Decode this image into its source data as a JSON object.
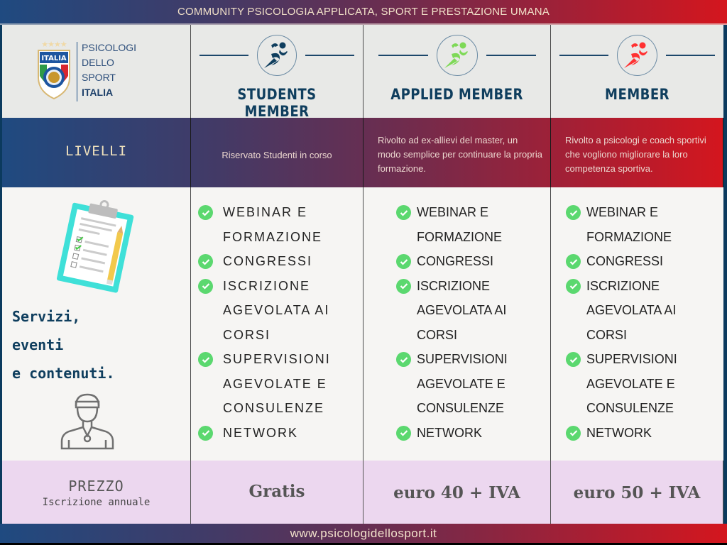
{
  "header": {
    "title": "COMMUNITY PSICOLOGIA APPLICATA, SPORT E PRESTAZIONE UMANA"
  },
  "logo": {
    "crest_label": "ITALIA",
    "stars": "★★★★",
    "lines": [
      "PSICOLOGI",
      "DELLO",
      "SPORT",
      "ITALIA"
    ]
  },
  "colors": {
    "navy": "#0f3e5e",
    "check_green": "#5bd86f",
    "runner_students": "#0f3e5e",
    "runner_applied": "#7ed957",
    "runner_member": "#ff3131",
    "price_row_bg": "#ecd7ef"
  },
  "plans": [
    {
      "title": "STUDENTS MEMBER",
      "icon": "runner-icon",
      "description": "Riservato Studenti in corso",
      "price": "Gratis",
      "features": [
        "WEBINAR E FORMAZIONE",
        "CONGRESSI",
        "ISCRIZIONE AGEVOLATA AI CORSI",
        "SUPERVISIONI AGEVOLATE E CONSULENZE",
        "NETWORK"
      ]
    },
    {
      "title": "APPLIED MEMBER",
      "icon": "runner-icon",
      "description": "Rivolto ad ex-allievi del master, un modo semplice per continuare la propria formazione.",
      "price": "euro 40 + IVA",
      "features": [
        "WEBINAR E FORMAZIONE",
        "CONGRESSI",
        "ISCRIZIONE AGEVOLATA AI CORSI",
        "SUPERVISIONI AGEVOLATE E CONSULENZE",
        "NETWORK"
      ]
    },
    {
      "title": "MEMBER",
      "icon": "runner-icon",
      "description": "Rivolto a psicologi e coach sportivi che vogliono migliorare la loro competenza sportiva.",
      "price": "euro 50 + IVA",
      "features": [
        "WEBINAR E FORMAZIONE",
        "CONGRESSI",
        "ISCRIZIONE AGEVOLATA AI CORSI",
        "SUPERVISIONI AGEVOLATE E CONSULENZE",
        "NETWORK"
      ]
    }
  ],
  "rows": {
    "levels_label": "LIVELLI",
    "services_label": [
      "Servizi,",
      "eventi",
      "e contenuti."
    ],
    "price_label": "PREZZO",
    "price_sublabel": "Iscrizione annuale"
  },
  "footer": {
    "url": "www.psicologidellosport.it"
  }
}
